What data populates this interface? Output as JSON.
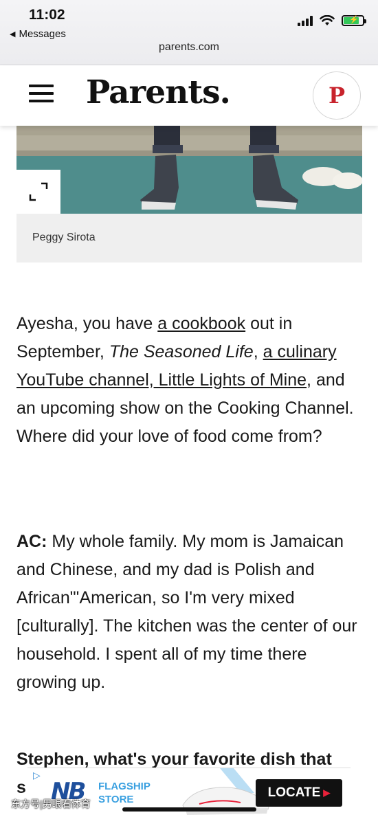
{
  "status_bar": {
    "time": "11:02",
    "back_label": "Messages",
    "url": "parents.com"
  },
  "header": {
    "logo": "Parents.",
    "menu_icon": "hamburger-menu-icon",
    "pin_glyph": "P"
  },
  "image": {
    "caption": "Peggy Sirota"
  },
  "article": {
    "p1": {
      "t1": "Ayesha, you have ",
      "link1": "a cookbook",
      "t2": " out in September, ",
      "title_italic": "The Seasoned Life",
      "t3": ", ",
      "link2": "a culinary YouTube channel, Little Lights of Mine",
      "t4": ", and an upcoming show on the Cooking Channel. Where did your love of food come from?"
    },
    "p2": {
      "speaker": "AC:",
      "text": " My whole family. My mom is Jamaican and Chinese, and my dad is Polish and African\"'American, so I'm very mixed [culturally]. The kitchen was the center of our household. I spent all of my time there growing up."
    },
    "p3": {
      "line": "Stephen, what's your favorite dish that",
      "overflow_char": "s"
    }
  },
  "ad": {
    "brand_glyph": "NB",
    "flagship": "FLAGSHIP",
    "store": "STORE",
    "locate": "LOCATE"
  },
  "watermark": "东方号|另眼看体育",
  "colors": {
    "pinterest": "#c8232c",
    "ad_blue": "#3aa0e0",
    "ad_navy": "#1e4f9c",
    "battery_green": "#34c759"
  }
}
